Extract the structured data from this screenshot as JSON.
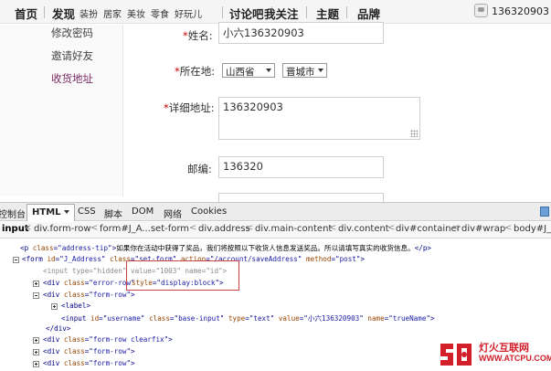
{
  "topnav": {
    "home": "首页",
    "discover": "发现",
    "discover_sub": [
      "装扮",
      "居家",
      "美妆",
      "零食",
      "好玩儿"
    ],
    "forum": "讨论吧",
    "following": "我关注",
    "topics": "主题",
    "brands": "品牌",
    "user_name": "136320903"
  },
  "sidebar": {
    "items": [
      {
        "label": "修改密码",
        "active": false
      },
      {
        "label": "邀请好友",
        "active": false
      },
      {
        "label": "收货地址",
        "active": true
      }
    ]
  },
  "form": {
    "name_label": "姓名:",
    "name_value": "小六136320903",
    "location_label": "所在地:",
    "province": "山西省",
    "city": "晋城市",
    "address_label": "详细地址:",
    "address_value": "136320903",
    "postcode_label": "邮编:",
    "postcode_value": "136320"
  },
  "devtools": {
    "tabs": [
      "控制台",
      "HTML",
      "CSS",
      "脚本",
      "DOM",
      "网络",
      "Cookies"
    ],
    "active_tab": "HTML",
    "breadcrumb": [
      "input",
      "div.form-row",
      "form#J_A...set-form",
      "div.address",
      "div.main-content",
      "div.content",
      "div#container",
      "div#wrap",
      "body#J_B"
    ]
  },
  "tree": {
    "address_tip_text": "如果你在活动中获得了奖品，我们将按照以下收货人信息发送奖品。所以请填写真实的收货信息。",
    "form_id": "J_Address",
    "form_class": "set-form",
    "form_action": "/account/saveAddress",
    "form_method": "post",
    "hidden_type": "hidden",
    "hidden_value": "1003",
    "hidden_name": "id",
    "error_row_class": "error-row",
    "error_row_style": "display:block",
    "form_row_class": "form-row",
    "label_tag": "label",
    "input_id": "username",
    "input_class": "base-input",
    "input_type": "text",
    "input_value": "小六136320903",
    "input_name": "trueName",
    "clearfix_class": "form-row clearfix"
  },
  "watermark": {
    "name": "灯火互联网",
    "url": "WWW.ATCPU.COM"
  },
  "colors": {
    "active_sidebar": "#7a2a64",
    "required": "#cc0000",
    "highlight_box": "#c84646",
    "watermark": "#d21f2a"
  }
}
